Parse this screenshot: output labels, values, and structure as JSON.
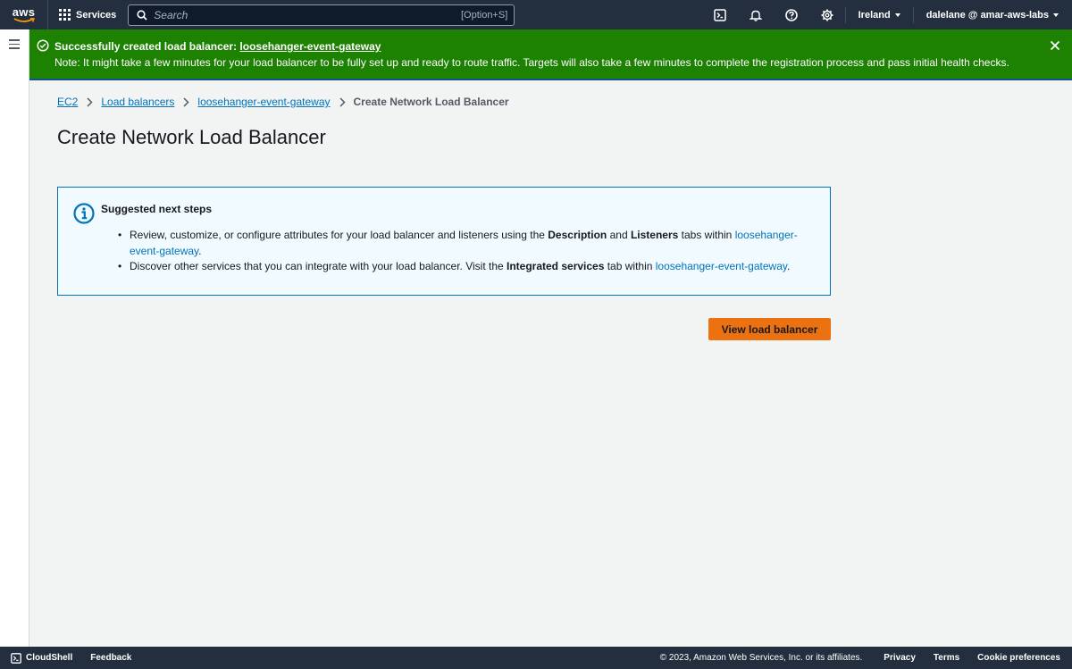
{
  "topnav": {
    "logo_text": "aws",
    "services_label": "Services",
    "search_placeholder": "Search",
    "search_shortcut": "[Option+S]",
    "region": "Ireland",
    "account": "dalelane @ amar-aws-labs"
  },
  "flash": {
    "title_prefix": "Successfully created load balancer: ",
    "title_link": "loosehanger-event-gateway",
    "note": "Note: It might take a few minutes for your load balancer to be fully set up and ready to route traffic. Targets will also take a few minutes to complete the registration process and pass initial health checks.",
    "color": "#1d8102"
  },
  "breadcrumb": {
    "items": [
      "EC2",
      "Load balancers",
      "loosehanger-event-gateway"
    ],
    "current": "Create Network Load Balancer"
  },
  "page": {
    "title": "Create Network Load Balancer"
  },
  "info": {
    "title": "Suggested next steps",
    "step1": {
      "a": "Review, customize, or configure attributes for your load balancer and listeners using the ",
      "b": "Description",
      "c": " and ",
      "d": "Listeners",
      "e": " tabs within ",
      "link": "loosehanger-event-gateway",
      "f": "."
    },
    "step2": {
      "a": "Discover other services that you can integrate with your load balancer. Visit the ",
      "b": "Integrated services",
      "c": " tab within ",
      "link": "loosehanger-event-gateway",
      "f": "."
    }
  },
  "actions": {
    "view_label": "View load balancer",
    "accent": "#ec7211"
  },
  "footer": {
    "cloudshell": "CloudShell",
    "feedback": "Feedback",
    "copyright": "© 2023, Amazon Web Services, Inc. or its affiliates.",
    "privacy": "Privacy",
    "terms": "Terms",
    "cookies": "Cookie preferences"
  }
}
